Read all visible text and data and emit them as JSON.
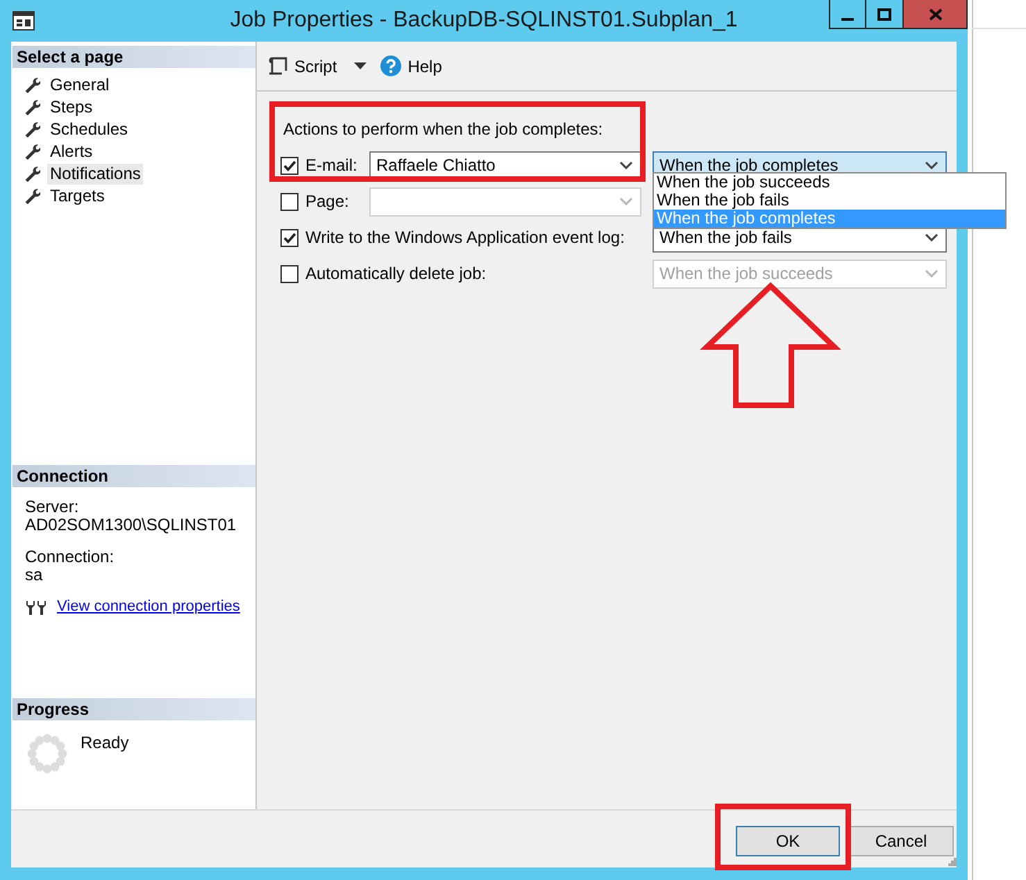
{
  "window": {
    "title": "Job Properties - BackupDB-SQLINST01.Subplan_1"
  },
  "sidebar": {
    "heading": "Select a page",
    "items": [
      {
        "label": "General",
        "selected": false
      },
      {
        "label": "Steps",
        "selected": false
      },
      {
        "label": "Schedules",
        "selected": false
      },
      {
        "label": "Alerts",
        "selected": false
      },
      {
        "label": "Notifications",
        "selected": true
      },
      {
        "label": "Targets",
        "selected": false
      }
    ]
  },
  "connection": {
    "heading": "Connection",
    "server_label": "Server:",
    "server": "AD02SOM1300\\SQLINST01",
    "connection_label": "Connection:",
    "connection": "sa",
    "link": "View connection properties"
  },
  "progress": {
    "heading": "Progress",
    "status": "Ready"
  },
  "toolbar": [
    {
      "label": "Script",
      "kind": "script"
    },
    {
      "label": "Help",
      "kind": "help"
    }
  ],
  "actions": {
    "heading": "Actions to perform when the job completes:",
    "rows": [
      {
        "kind": "recipient",
        "label": "E-mail:",
        "checked": true,
        "value": "Raffaele Chiatto",
        "condition": "When the job completes",
        "disabled": false,
        "focused": true
      },
      {
        "kind": "recipient",
        "label": "Page:",
        "checked": false,
        "disabled": true
      },
      {
        "kind": "plain",
        "label": "Write to the Windows Application event log:",
        "checked": true,
        "condition": "When the job fails",
        "disabled": false,
        "focused": false
      },
      {
        "kind": "plain",
        "label": "Automatically delete job:",
        "checked": false,
        "condition": "When the job succeeds",
        "disabled": true,
        "focused": false
      }
    ]
  },
  "dropdown_list": {
    "options": [
      {
        "label": "When the job succeeds",
        "selected": false
      },
      {
        "label": "When the job fails",
        "selected": false
      },
      {
        "label": "When the job completes",
        "selected": true
      }
    ]
  },
  "buttons": [
    {
      "label": "OK",
      "default": true
    },
    {
      "label": "Cancel",
      "default": false
    }
  ]
}
